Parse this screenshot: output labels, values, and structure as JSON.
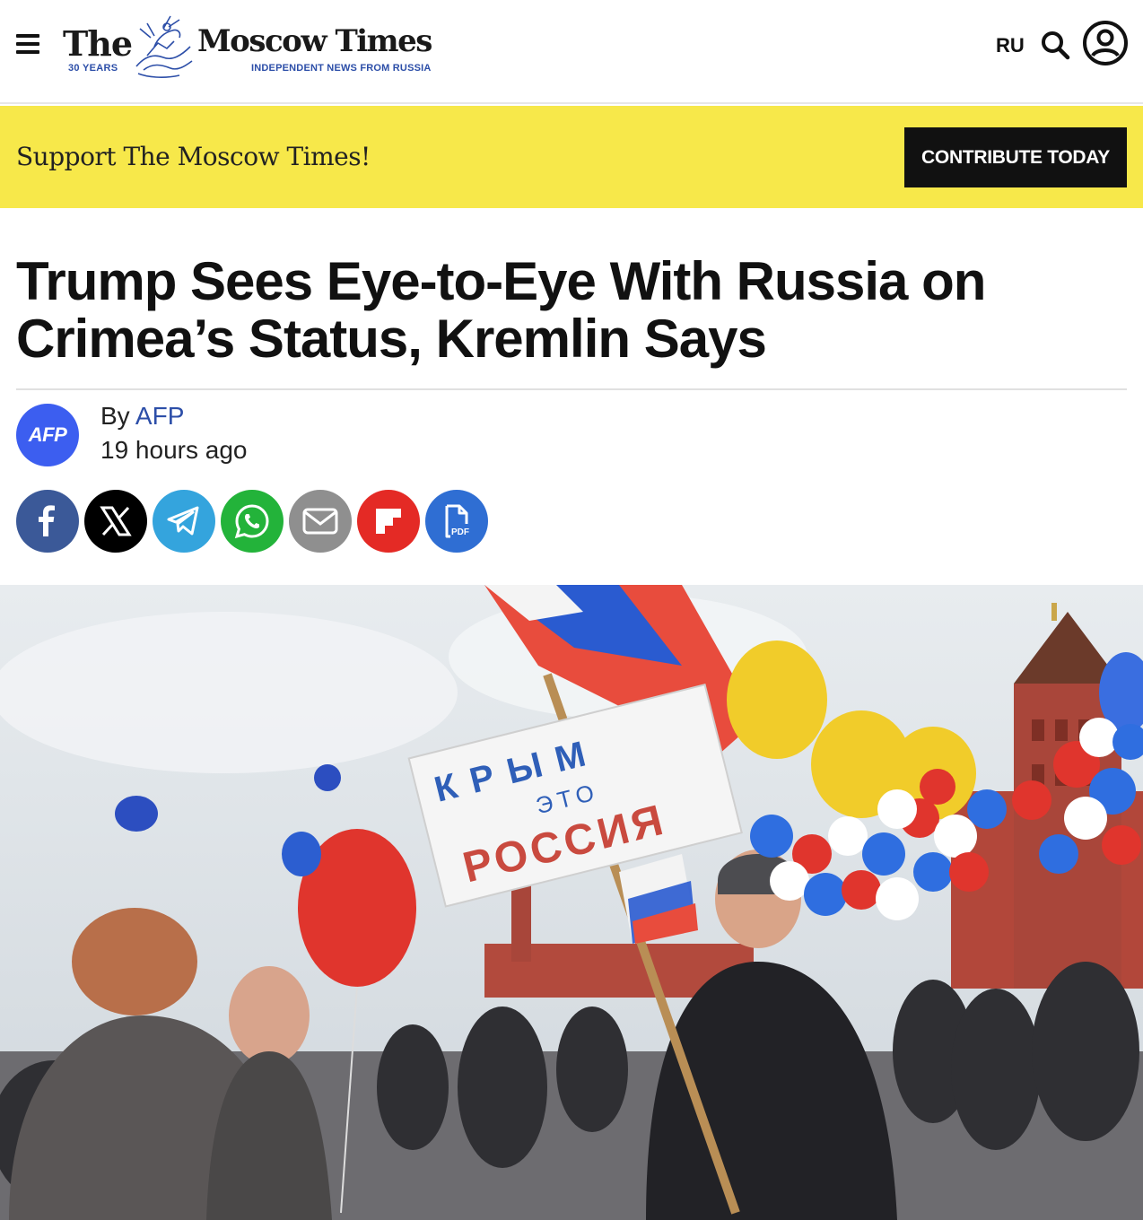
{
  "header": {
    "logo_the": "The",
    "logo_name": "Moscow Times",
    "logo_years": "30 YEARS",
    "logo_tagline": "INDEPENDENT NEWS FROM RUSSIA",
    "lang_switch": "RU",
    "icons": [
      "menu-icon",
      "search-icon",
      "account-icon"
    ]
  },
  "banner": {
    "message": "Support The Moscow Times!",
    "cta_label": "CONTRIBUTE TODAY",
    "background": "#f7e84a"
  },
  "article": {
    "headline": "Trump Sees Eye-to-Eye With Russia on Crimea’s Status, Kremlin Says",
    "author_avatar_text": "AFP",
    "by_prefix": "By",
    "author": "AFP",
    "published": "19 hours ago",
    "share_buttons": [
      {
        "name": "facebook",
        "color": "#3b5998"
      },
      {
        "name": "x",
        "color": "#000000"
      },
      {
        "name": "telegram",
        "color": "#34a4dd"
      },
      {
        "name": "whatsapp",
        "color": "#23b33a"
      },
      {
        "name": "email",
        "color": "#8f8f8f"
      },
      {
        "name": "flipboard",
        "color": "#e42a25"
      },
      {
        "name": "pdf",
        "color": "#2f6ed3"
      }
    ],
    "pdf_label": "PDF",
    "photo_sign_lines": [
      "КРЫМ",
      "ЭТО",
      "РОССИЯ"
    ]
  }
}
